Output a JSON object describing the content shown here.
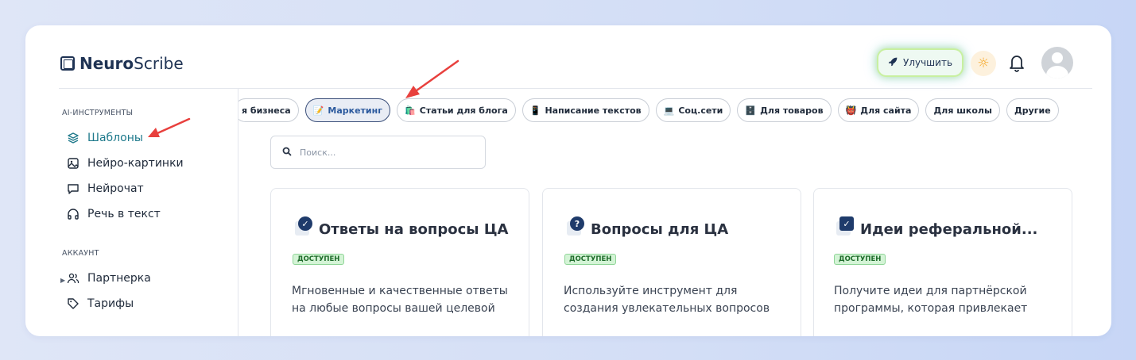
{
  "app": {
    "logo_bold": "Neuro",
    "logo_light": "Scribe"
  },
  "header": {
    "upgrade_label": "Улучшить",
    "upgrade_icon": "rocket-icon",
    "theme_icon": "sun-icon",
    "notifications_icon": "bell-icon",
    "avatar_icon": "user-avatar"
  },
  "sidebar": {
    "tools_title": "AI-ИНСТРУМЕНТЫ",
    "tools": [
      {
        "label": "Шаблоны",
        "icon": "layers-icon",
        "active": true
      },
      {
        "label": "Нейро-картинки",
        "icon": "image-icon"
      },
      {
        "label": "Нейрочат",
        "icon": "chat-icon"
      },
      {
        "label": "Речь в текст",
        "icon": "headphones-icon"
      }
    ],
    "account_title": "АККАУНТ",
    "account": [
      {
        "label": "Партнерка",
        "icon": "users-icon"
      },
      {
        "label": "Тарифы",
        "icon": "tag-icon"
      }
    ]
  },
  "tabs": [
    {
      "label": "я бизнеса",
      "emoji": ""
    },
    {
      "label": "Маркетинг",
      "emoji": "📝",
      "active": true
    },
    {
      "label": "Статьи для блога",
      "emoji": "🛍️"
    },
    {
      "label": "Написание текстов",
      "emoji": "📱"
    },
    {
      "label": "Соц.сети",
      "emoji": "💻"
    },
    {
      "label": "Для товаров",
      "emoji": "🗄️"
    },
    {
      "label": "Для сайта",
      "emoji": "👹"
    },
    {
      "label": "Для школы",
      "emoji": ""
    },
    {
      "label": "Другие",
      "emoji": ""
    }
  ],
  "search": {
    "placeholder": "Поиск..."
  },
  "cards": [
    {
      "title": "Ответы на вопросы ЦА",
      "badge": "ДОСТУПЕН",
      "icon": "check-badge-icon",
      "description": "Мгновенные и качественные ответы на любые вопросы вашей целевой"
    },
    {
      "title": "Вопросы для ЦА",
      "badge": "ДОСТУПЕН",
      "icon": "question-badge-icon",
      "description": "Используйте инструмент для создания увлекательных вопросов"
    },
    {
      "title": "Идеи реферальной...",
      "badge": "ДОСТУПЕН",
      "icon": "checkbox-icon",
      "description": "Получите идеи для партнёрской программы, которая привлекает"
    }
  ],
  "colors": {
    "accent": "#1f7a8c",
    "annotation_arrow": "#e8403d",
    "badge_bg": "#d4f4d6"
  }
}
